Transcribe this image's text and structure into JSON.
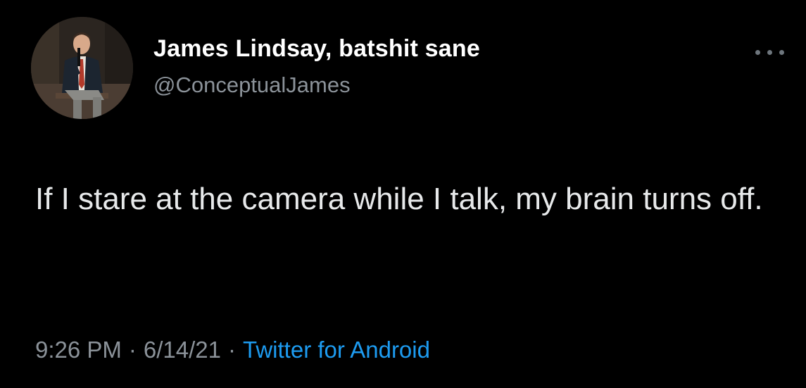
{
  "user": {
    "display_name": "James Lindsay, batshit sane",
    "handle": "@ConceptualJames",
    "avatar_icon": "profile-photo"
  },
  "tweet": {
    "text": "If I stare at the camera while I talk, my brain turns off."
  },
  "meta": {
    "time": "9:26 PM",
    "separator": "·",
    "date": "6/14/21",
    "source": "Twitter for Android"
  },
  "more_icon": "more-options-icon",
  "colors": {
    "background": "#000000",
    "name": "#ffffff",
    "secondary": "#8b9299",
    "link": "#1d9bf0"
  }
}
